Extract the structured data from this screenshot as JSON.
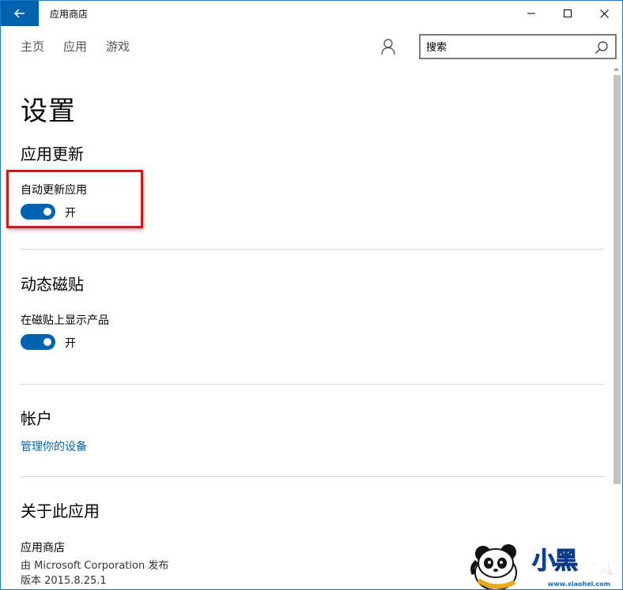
{
  "window": {
    "title": "应用商店"
  },
  "nav": {
    "tabs": [
      "主页",
      "应用",
      "游戏"
    ],
    "search_placeholder": "搜索"
  },
  "page": {
    "title": "设置"
  },
  "sections": {
    "app_updates": {
      "title": "应用更新",
      "setting_label": "自动更新应用",
      "toggle_state": "开",
      "toggle_on": true
    },
    "live_tiles": {
      "title": "动态磁贴",
      "setting_label": "在磁贴上显示产品",
      "toggle_state": "开",
      "toggle_on": true
    },
    "account": {
      "title": "帐户",
      "link": "管理你的设备"
    },
    "about": {
      "title": "关于此应用",
      "app_name": "应用商店",
      "publisher": "由 Microsoft Corporation 发布",
      "version": "版本 2015.8.25.1"
    }
  },
  "watermark": {
    "brand": "小黑",
    "brand_suffix": "游戏",
    "site": "www.xiaohei.com"
  },
  "colors": {
    "accent": "#0063b1",
    "highlight": "#d0161a"
  }
}
